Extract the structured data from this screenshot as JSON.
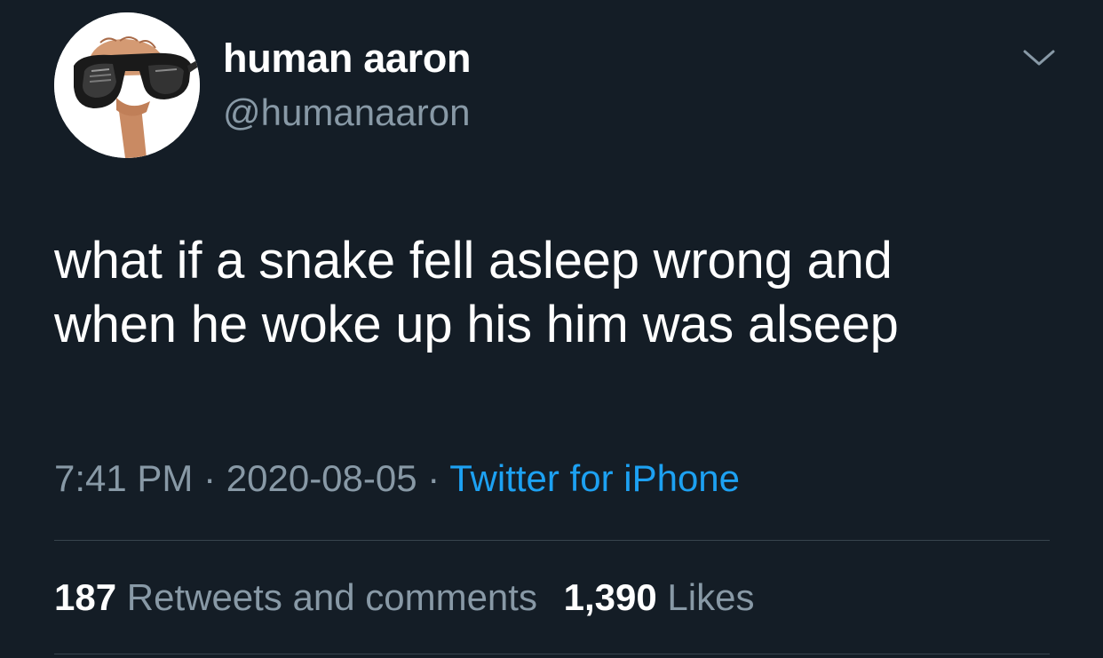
{
  "author": {
    "display_name": "human aaron",
    "handle": "@humanaaron",
    "avatar_icon": "hand-holding-sunglasses-avatar"
  },
  "menu": {
    "icon": "chevron-down-icon"
  },
  "tweet": {
    "lines": [
      "what if a snake fell asleep wrong and",
      "when he woke up his him was alseep"
    ]
  },
  "meta": {
    "time": "7:41 PM",
    "separator": "·",
    "date": "2020-08-05",
    "source": "Twitter for iPhone"
  },
  "stats": {
    "retweets_count": "187",
    "retweets_label": "Retweets and comments",
    "likes_count": "1,390",
    "likes_label": "Likes"
  },
  "colors": {
    "background": "#141d26",
    "primary_text": "#ffffff",
    "secondary_text": "#8899a6",
    "link": "#1da1f2",
    "divider": "#38444d"
  }
}
